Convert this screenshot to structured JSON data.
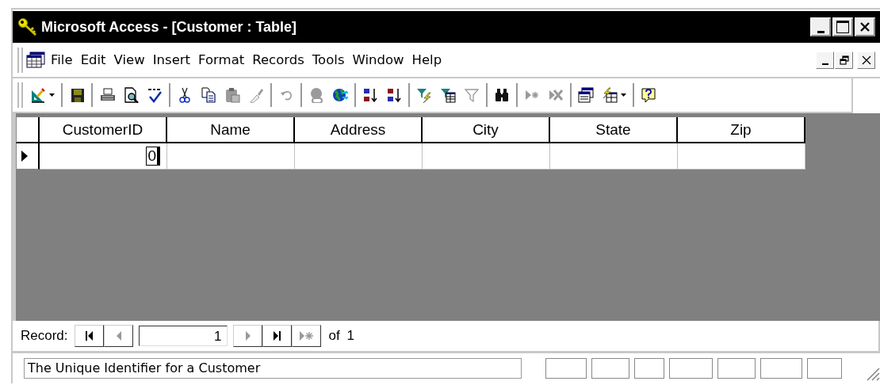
{
  "window": {
    "title": "Microsoft Access - [Customer : Table]"
  },
  "menu": [
    "File",
    "Edit",
    "View",
    "Insert",
    "Format",
    "Records",
    "Tools",
    "Window",
    "Help"
  ],
  "toolbar": [
    {
      "kind": "design",
      "disabled": false
    },
    {
      "kind": "separator"
    },
    {
      "kind": "save",
      "disabled": false
    },
    {
      "kind": "separator"
    },
    {
      "kind": "print",
      "disabled": false
    },
    {
      "kind": "preview",
      "disabled": false
    },
    {
      "kind": "spelling",
      "disabled": false
    },
    {
      "kind": "separator"
    },
    {
      "kind": "cut",
      "disabled": false
    },
    {
      "kind": "copy",
      "disabled": false
    },
    {
      "kind": "paste",
      "disabled": true
    },
    {
      "kind": "painter",
      "disabled": true
    },
    {
      "kind": "separator"
    },
    {
      "kind": "undo",
      "disabled": true
    },
    {
      "kind": "separator"
    },
    {
      "kind": "hyperlink",
      "disabled": true
    },
    {
      "kind": "web",
      "disabled": false
    },
    {
      "kind": "separator"
    },
    {
      "kind": "sort-asc",
      "disabled": false
    },
    {
      "kind": "sort-desc",
      "disabled": false
    },
    {
      "kind": "separator"
    },
    {
      "kind": "filter-selection",
      "disabled": false
    },
    {
      "kind": "filter-form",
      "disabled": false
    },
    {
      "kind": "apply-filter",
      "disabled": true
    },
    {
      "kind": "separator"
    },
    {
      "kind": "find",
      "disabled": false
    },
    {
      "kind": "separator"
    },
    {
      "kind": "new-record",
      "disabled": true
    },
    {
      "kind": "delete-record",
      "disabled": true
    },
    {
      "kind": "separator"
    },
    {
      "kind": "database-window",
      "disabled": false
    },
    {
      "kind": "new-object",
      "disabled": false
    },
    {
      "kind": "separator"
    },
    {
      "kind": "help",
      "disabled": false
    }
  ],
  "table": {
    "columns": [
      "CustomerID",
      "Name",
      "Address",
      "City",
      "State",
      "Zip"
    ],
    "rows": [
      {
        "selected": true,
        "cells": {
          "0": "0"
        }
      }
    ]
  },
  "navigation": {
    "label": "Record:",
    "current": "1",
    "total": "of 1",
    "buttons": [
      {
        "kind": "first",
        "disabled": false
      },
      {
        "kind": "previous",
        "disabled": true
      },
      {
        "kind": "next",
        "disabled": true
      },
      {
        "kind": "last",
        "disabled": false
      },
      {
        "kind": "new",
        "disabled": true
      }
    ]
  },
  "status_bar": {
    "text": "The Unique Identifier for a Customer"
  }
}
